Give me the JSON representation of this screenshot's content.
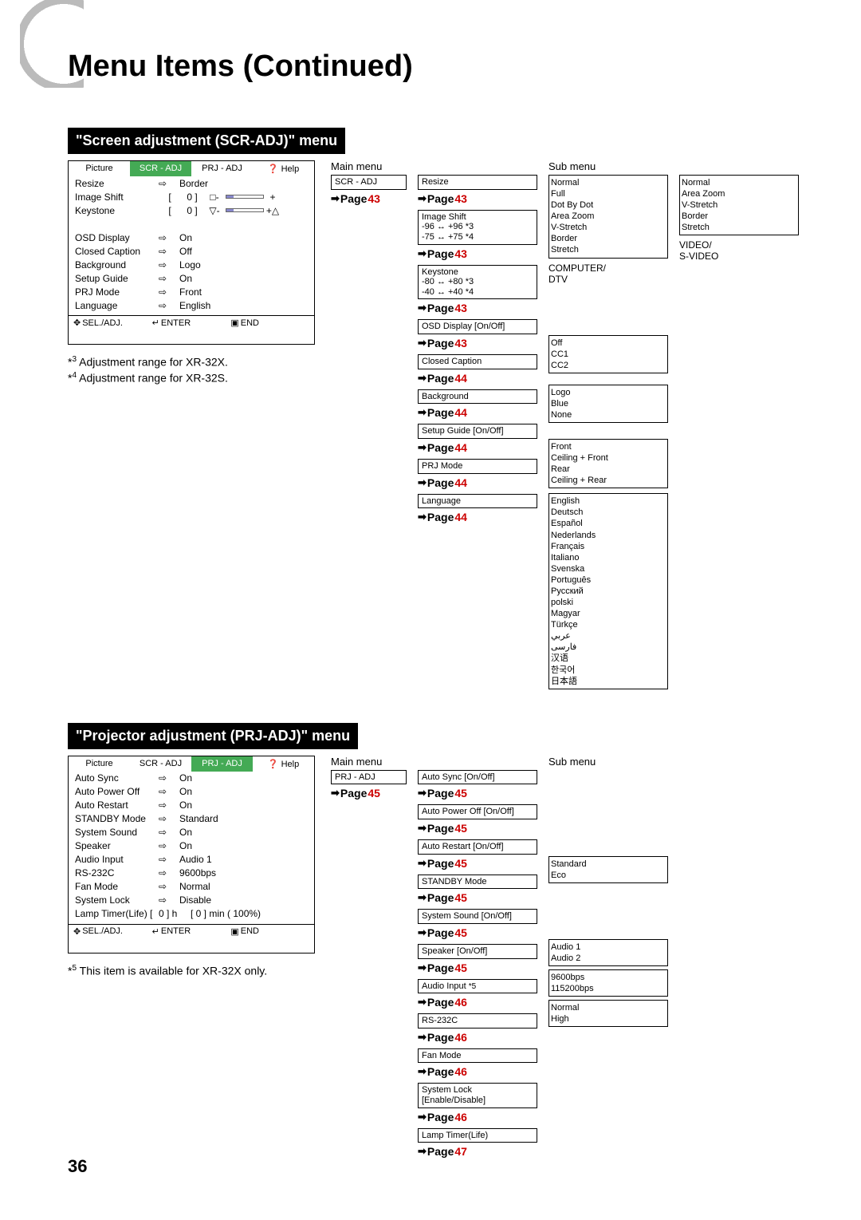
{
  "title": "Menu Items (Continued)",
  "page_num": "36",
  "scr": {
    "heading": "\"Screen adjustment (SCR-ADJ)\" menu",
    "tabs": [
      "Picture",
      "SCR - ADJ",
      "PRJ - ADJ",
      "Help"
    ],
    "rows": [
      {
        "n": "Resize",
        "i": "⇨",
        "v": "Border"
      },
      {
        "n": "Image Shift",
        "i": "[",
        "m": "0 ]",
        "s": true,
        "sym": "□",
        "p": "+"
      },
      {
        "n": "Keystone",
        "i": "[",
        "m": "0 ]",
        "s": true,
        "sym": "▽",
        "p": "+△"
      },
      {
        "n": "",
        "i": "",
        "v": ""
      },
      {
        "n": "OSD Display",
        "i": "⇨",
        "v": "On"
      },
      {
        "n": "Closed Caption",
        "i": "⇨",
        "v": "Off"
      },
      {
        "n": "Background",
        "i": "⇨",
        "v": "Logo"
      },
      {
        "n": "Setup Guide",
        "i": "⇨",
        "v": "On"
      },
      {
        "n": "PRJ Mode",
        "i": "⇨",
        "v": "Front"
      },
      {
        "n": "Language",
        "i": "⇨",
        "v": "English"
      }
    ],
    "footer": {
      "sel": "SEL./ADJ.",
      "enter": "ENTER",
      "end": "END"
    },
    "notes": [
      {
        "sup": "3",
        "t": " Adjustment range for XR-32X."
      },
      {
        "sup": "4",
        "t": " Adjustment range for XR-32S."
      }
    ],
    "main_h": "Main menu",
    "sub_h": "Sub menu",
    "main_top": "SCR - ADJ",
    "main_pref": "Page 43",
    "col2": [
      {
        "box": "Resize",
        "p": "43"
      },
      {
        "box": "Image Shift\n-96 ↔ +96 *3\n-75 ↔ +75 *4",
        "p": "43"
      },
      {
        "box": "Keystone\n-80 ↔ +80 *3\n-40 ↔ +40 *4",
        "p": "43"
      },
      {
        "box": "OSD Display [On/Off]",
        "p": "43"
      },
      {
        "box": "Closed Caption",
        "p": "44"
      },
      {
        "box": "Background",
        "p": "44"
      },
      {
        "box": "Setup Guide [On/Off]",
        "p": "44"
      },
      {
        "box": "PRJ Mode",
        "p": "44"
      },
      {
        "box": "Language",
        "p": "44"
      }
    ],
    "sub1": {
      "items": [
        "Normal",
        "Full",
        "Dot By Dot",
        "Area Zoom",
        "V-Stretch",
        "Border",
        "Stretch"
      ],
      "label": "COMPUTER/\nDTV"
    },
    "sub2": {
      "items": [
        "Normal",
        "Area Zoom",
        "V-Stretch",
        "Border",
        "Stretch"
      ],
      "label": "VIDEO/\nS-VIDEO"
    },
    "sub3": [
      "Off",
      "CC1",
      "CC2"
    ],
    "sub4": [
      "Logo",
      "Blue",
      "None"
    ],
    "sub5": [
      "Front",
      "Ceiling + Front",
      "Rear",
      "Ceiling + Rear"
    ],
    "sub6": [
      "English",
      "Deutsch",
      "Español",
      "Nederlands",
      "Français",
      "Italiano",
      "Svenska",
      "Português",
      "Русский",
      "polski",
      "Magyar",
      "Türkçe",
      "عربي",
      "فارسی",
      "汉语",
      "한국어",
      "日本語"
    ]
  },
  "prj": {
    "heading": "\"Projector adjustment (PRJ-ADJ)\" menu",
    "tabs": [
      "Picture",
      "SCR - ADJ",
      "PRJ - ADJ",
      "Help"
    ],
    "rows": [
      {
        "n": "Auto Sync",
        "i": "⇨",
        "v": "On"
      },
      {
        "n": "Auto Power Off",
        "i": "⇨",
        "v": "On"
      },
      {
        "n": "Auto Restart",
        "i": "⇨",
        "v": "On"
      },
      {
        "n": "STANDBY Mode",
        "i": "⇨",
        "v": "Standard"
      },
      {
        "n": "System Sound",
        "i": "⇨",
        "v": "On"
      },
      {
        "n": "Speaker",
        "i": "⇨",
        "v": "On"
      },
      {
        "n": "Audio Input",
        "i": "⇨",
        "v": "Audio 1"
      },
      {
        "n": "RS-232C",
        "i": "⇨",
        "v": "9600bps"
      },
      {
        "n": "Fan Mode",
        "i": "⇨",
        "v": "Normal"
      },
      {
        "n": "System Lock",
        "i": "⇨",
        "v": "Disable"
      },
      {
        "n": "Lamp Timer(Life)   [",
        "m": "0 ] h",
        "v2": "[       0 ] min ( 100%)"
      }
    ],
    "footer": {
      "sel": "SEL./ADJ.",
      "enter": "ENTER",
      "end": "END"
    },
    "note_sup": "5",
    "note_t": " This item is available for XR-32X only.",
    "main_h": "Main menu",
    "sub_h": "Sub menu",
    "main_top": "PRJ - ADJ",
    "main_pref": "Page 45",
    "col2": [
      {
        "box": "Auto Sync [On/Off]",
        "p": "45"
      },
      {
        "box": "Auto Power Off [On/Off]",
        "p": "45"
      },
      {
        "box": "Auto Restart [On/Off]",
        "p": "45"
      },
      {
        "box": "STANDBY Mode",
        "p": "45"
      },
      {
        "box": "System Sound [On/Off]",
        "p": "45"
      },
      {
        "box": "Speaker [On/Off]",
        "p": "45"
      },
      {
        "box": "Audio Input",
        "star": "*5",
        "p": "46"
      },
      {
        "box": "RS-232C",
        "p": "46"
      },
      {
        "box": "Fan Mode",
        "p": "46"
      },
      {
        "box": "System Lock\n[Enable/Disable]",
        "p": "46"
      },
      {
        "box": "Lamp Timer(Life)",
        "p": "47"
      }
    ],
    "r3": [
      [
        "Standard",
        "Eco"
      ],
      [
        "Audio 1",
        "Audio 2"
      ],
      [
        "9600bps",
        "115200bps"
      ],
      [
        "Normal",
        "High"
      ]
    ]
  }
}
